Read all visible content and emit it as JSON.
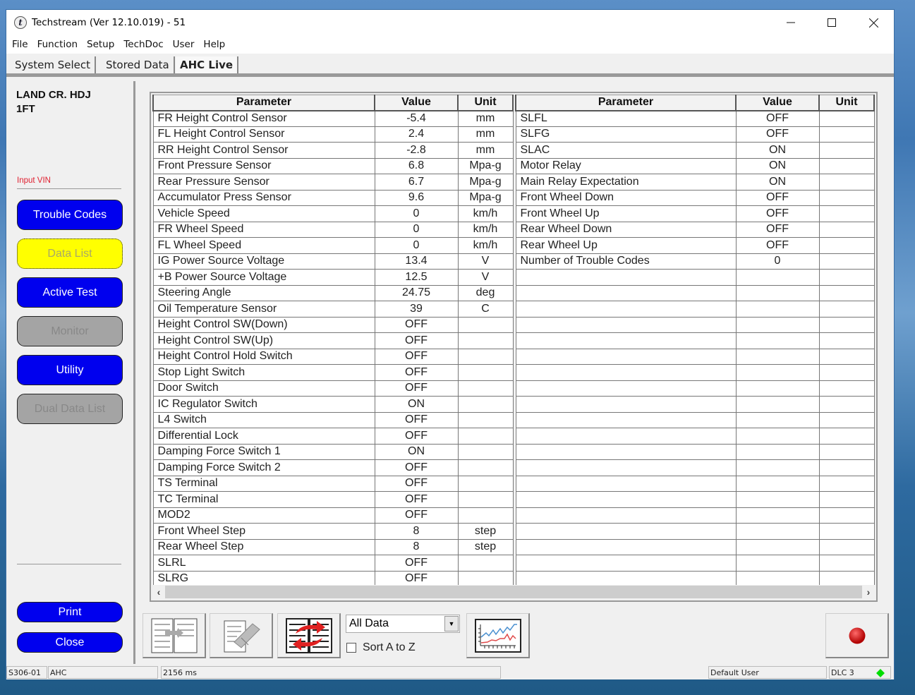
{
  "window": {
    "title": "Techstream (Ver 12.10.019) - 51",
    "app_icon": "techstream-t-icon",
    "controls": {
      "minimize": "—",
      "maximize": "☐",
      "close": "✕"
    }
  },
  "menu": [
    "File",
    "Function",
    "Setup",
    "TechDoc",
    "User",
    "Help"
  ],
  "tabs": [
    {
      "label": "System Select",
      "active": false
    },
    {
      "label": "Stored Data",
      "active": false
    },
    {
      "label": "AHC Live",
      "active": true
    }
  ],
  "sidebar": {
    "vehicle_line1": "LAND CR. HDJ",
    "vehicle_line2": "1FT",
    "input_vin": "Input VIN",
    "buttons": [
      {
        "label": "Trouble Codes",
        "state": "enabled"
      },
      {
        "label": "Data List",
        "state": "selected"
      },
      {
        "label": "Active Test",
        "state": "enabled"
      },
      {
        "label": "Monitor",
        "state": "disabled"
      },
      {
        "label": "Utility",
        "state": "enabled"
      },
      {
        "label": "Dual Data List",
        "state": "disabled"
      }
    ],
    "print_label": "Print",
    "close_label": "Close"
  },
  "table": {
    "headers": [
      "Parameter",
      "Value",
      "Unit"
    ],
    "left_rows": [
      [
        "FR Height Control Sensor",
        "-5.4",
        "mm"
      ],
      [
        "FL Height Control Sensor",
        "2.4",
        "mm"
      ],
      [
        "RR Height Control Sensor",
        "-2.8",
        "mm"
      ],
      [
        "Front Pressure Sensor",
        "6.8",
        "Mpa-g"
      ],
      [
        "Rear Pressure Sensor",
        "6.7",
        "Mpa-g"
      ],
      [
        "Accumulator Press Sensor",
        "9.6",
        "Mpa-g"
      ],
      [
        "Vehicle Speed",
        "0",
        "km/h"
      ],
      [
        "FR Wheel Speed",
        "0",
        "km/h"
      ],
      [
        "FL Wheel Speed",
        "0",
        "km/h"
      ],
      [
        "IG Power Source Voltage",
        "13.4",
        "V"
      ],
      [
        "+B Power Source Voltage",
        "12.5",
        "V"
      ],
      [
        "Steering Angle",
        "24.75",
        "deg"
      ],
      [
        "Oil Temperature Sensor",
        "39",
        "C"
      ],
      [
        "Height Control SW(Down)",
        "OFF",
        ""
      ],
      [
        "Height Control SW(Up)",
        "OFF",
        ""
      ],
      [
        "Height Control Hold Switch",
        "OFF",
        ""
      ],
      [
        "Stop Light Switch",
        "OFF",
        ""
      ],
      [
        "Door Switch",
        "OFF",
        ""
      ],
      [
        "IC Regulator Switch",
        "ON",
        ""
      ],
      [
        "L4 Switch",
        "OFF",
        ""
      ],
      [
        "Differential Lock",
        "OFF",
        ""
      ],
      [
        "Damping Force Switch 1",
        "ON",
        ""
      ],
      [
        "Damping Force Switch 2",
        "OFF",
        ""
      ],
      [
        "TS Terminal",
        "OFF",
        ""
      ],
      [
        "TC Terminal",
        "OFF",
        ""
      ],
      [
        "MOD2",
        "OFF",
        ""
      ],
      [
        "Front Wheel Step",
        "8",
        "step"
      ],
      [
        "Rear Wheel Step",
        "8",
        "step"
      ],
      [
        "SLRL",
        "OFF",
        ""
      ],
      [
        "SLRG",
        "OFF",
        ""
      ]
    ],
    "right_rows": [
      [
        "SLFL",
        "OFF",
        ""
      ],
      [
        "SLFG",
        "OFF",
        ""
      ],
      [
        "SLAC",
        "ON",
        ""
      ],
      [
        "Motor Relay",
        "ON",
        ""
      ],
      [
        "Main Relay Expectation",
        "ON",
        ""
      ],
      [
        "Front Wheel Down",
        "OFF",
        ""
      ],
      [
        "Front Wheel Up",
        "OFF",
        ""
      ],
      [
        "Rear Wheel Down",
        "OFF",
        ""
      ],
      [
        "Rear Wheel Up",
        "OFF",
        ""
      ],
      [
        "Number of Trouble Codes",
        "0",
        ""
      ]
    ],
    "scroll_left": "‹",
    "scroll_right": "›"
  },
  "toolbar": {
    "filter_value": "All Data",
    "sort_label": "Sort A to Z",
    "sort_checked": false
  },
  "statusbar": {
    "code": "S306-01",
    "system": "AHC",
    "timing": "2156 ms",
    "user": "Default User",
    "connection": "DLC 3",
    "connection_color": "#00dd00"
  },
  "colors": {
    "button_blue": "#0000ee",
    "button_selected": "#ffff00",
    "button_disabled": "#a4a4a4",
    "vin_red": "#e02030",
    "record_red": "#cc1111"
  }
}
